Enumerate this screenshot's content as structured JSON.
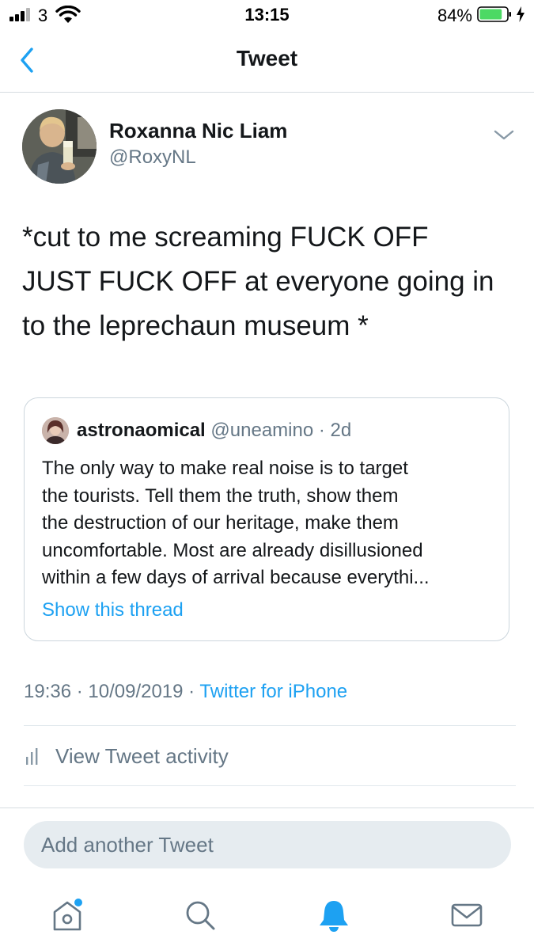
{
  "status_bar": {
    "carrier": "3",
    "time": "13:15",
    "battery_percent": "84%",
    "battery_level": 0.84,
    "signal_icon": "cellular-signal-icon",
    "wifi_icon": "wifi-icon",
    "battery_icon": "battery-icon",
    "charging_icon": "charging-bolt-icon",
    "battery_color": "#4cd964"
  },
  "nav": {
    "title": "Tweet",
    "back_icon": "chevron-left-icon",
    "accent_color": "#1da1f2"
  },
  "tweet": {
    "author_name": "Roxanna Nic Liam",
    "author_handle": "@RoxyNL",
    "menu_icon": "chevron-down-icon",
    "text": "*cut to me screaming FUCK OFF\nJUST FUCK OFF at everyone going in\nto the leprechaun museum *",
    "quoted": {
      "name": "astronaomical",
      "handle": "@uneamino",
      "separator": "·",
      "age": "2d",
      "text": "The only way to make real noise is to target\nthe tourists. Tell them the truth, show them\nthe destruction of our heritage, make them\nuncomfortable. Most are already disillusioned\nwithin a few days of arrival because everythi...",
      "show_thread": "Show this thread"
    },
    "timestamp": "19:36 · 10/09/2019 ·",
    "source": "Twitter for iPhone",
    "activity_label": "View Tweet activity",
    "activity_icon": "bar-chart-icon"
  },
  "reply": {
    "placeholder": "Add another Tweet"
  },
  "tab_bar": {
    "items": [
      {
        "icon": "home-icon",
        "has_notification_dot": true
      },
      {
        "icon": "search-icon",
        "has_notification_dot": false
      },
      {
        "icon": "bell-icon",
        "active": true
      },
      {
        "icon": "mail-icon",
        "has_notification_dot": false
      }
    ]
  }
}
